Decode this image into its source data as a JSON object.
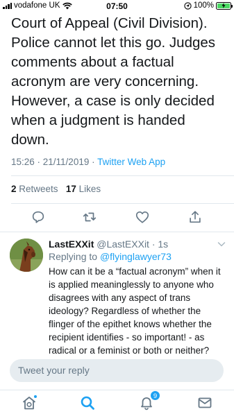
{
  "status_bar": {
    "carrier": "vodafone UK",
    "time": "07:50",
    "battery_percent": "100%",
    "battery_level": 1.0
  },
  "tweet": {
    "text": "Court of Appeal (Civil Division).\nPolice cannot let this go. Judges comments about a factual acronym are very concerning. However, a case is only decided when a judgment is handed down.",
    "time": "15:26 · 21/11/2019 · ",
    "source": "Twitter Web App",
    "retweets_count": "2",
    "retweets_label": "Retweets",
    "likes_count": "17",
    "likes_label": "Likes"
  },
  "reply": {
    "name": "LastEXXit",
    "handle": "@LastEXXit · 1s",
    "replying_prefix": "Replying to ",
    "replying_to": "@flyinglawyer73",
    "text": "How can it be a “factual acronym” when it is applied meaninglessly to anyone who disagrees with any aspect of trans ideology?  Regardless of whether the flinger of the epithet knows whether the recipient identifies - so important! - as radical or a feminist or both or neither?"
  },
  "compose": {
    "placeholder": "Tweet your reply"
  },
  "tabbar": {
    "notifications_badge": "9"
  },
  "colors": {
    "accent": "#1da1f2",
    "text_primary": "#14171a",
    "text_secondary": "#657786",
    "divider": "#e1e8ed",
    "compose_bg": "#e6ecf0"
  },
  "icons": [
    "wifi-icon",
    "signal-icon",
    "location-icon",
    "battery-icon",
    "reply-icon",
    "retweet-icon",
    "like-icon",
    "share-icon",
    "chevron-down-icon",
    "home-icon",
    "search-icon",
    "notifications-icon",
    "messages-icon"
  ]
}
